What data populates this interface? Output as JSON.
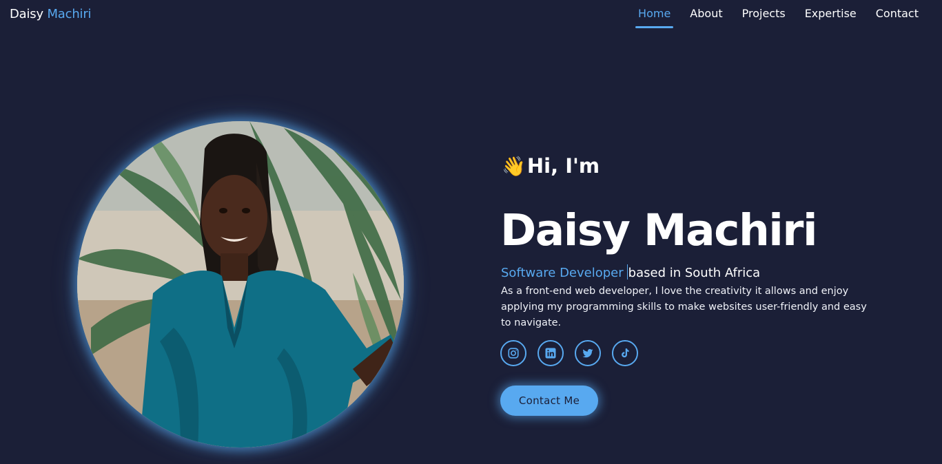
{
  "brand": {
    "first": "Daisy",
    "last": "Machiri"
  },
  "nav": {
    "items": [
      {
        "label": "Home",
        "active": true
      },
      {
        "label": "About",
        "active": false
      },
      {
        "label": "Projects",
        "active": false
      },
      {
        "label": "Expertise",
        "active": false
      },
      {
        "label": "Contact",
        "active": false
      }
    ]
  },
  "hero": {
    "wave_emoji": "👋",
    "greeting": "Hi, I'm",
    "name": "Daisy Machiri",
    "role_typed": "Software Developer",
    "role_rest": "based in South Africa",
    "bio": "As a front-end web developer, I love the creativity it allows and enjoy applying my programming skills to make websites user-friendly and easy to navigate.",
    "cta_label": "Contact Me"
  },
  "socials": [
    {
      "icon": "instagram-icon"
    },
    {
      "icon": "linkedin-icon"
    },
    {
      "icon": "twitter-icon"
    },
    {
      "icon": "tiktok-icon"
    }
  ],
  "colors": {
    "background": "#1b1f37",
    "accent": "#58a9f0",
    "text": "#ffffff"
  }
}
